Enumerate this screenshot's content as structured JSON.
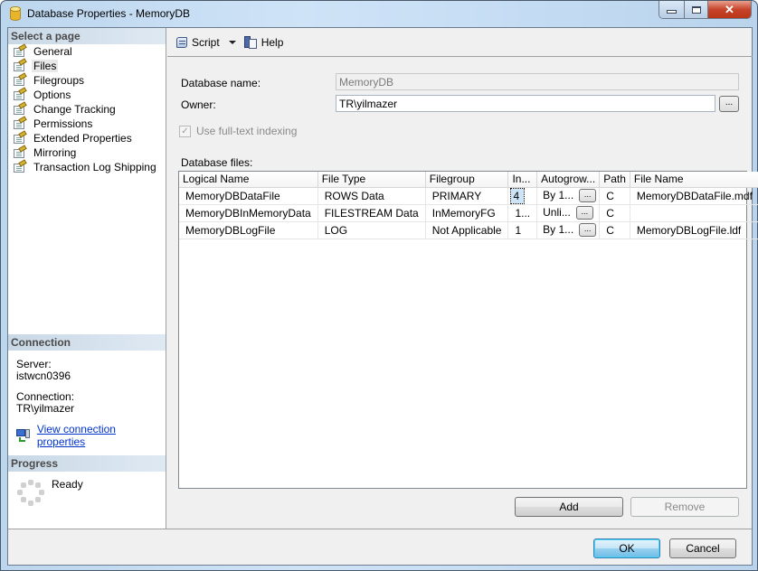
{
  "window": {
    "title": "Database Properties - MemoryDB",
    "controls": {
      "minimize": "minimize",
      "maximize": "maximize",
      "close": "✕"
    }
  },
  "sidebar": {
    "select_page_header": "Select a page",
    "pages": [
      {
        "label": "General",
        "selected": false
      },
      {
        "label": "Files",
        "selected": true
      },
      {
        "label": "Filegroups",
        "selected": false
      },
      {
        "label": "Options",
        "selected": false
      },
      {
        "label": "Change Tracking",
        "selected": false
      },
      {
        "label": "Permissions",
        "selected": false
      },
      {
        "label": "Extended Properties",
        "selected": false
      },
      {
        "label": "Mirroring",
        "selected": false
      },
      {
        "label": "Transaction Log Shipping",
        "selected": false
      }
    ],
    "connection": {
      "header": "Connection",
      "server_label": "Server:",
      "server_value": "istwcn0396",
      "connection_label": "Connection:",
      "connection_value": "TR\\yilmazer",
      "view_link": "View connection properties"
    },
    "progress": {
      "header": "Progress",
      "status": "Ready"
    }
  },
  "toolbar": {
    "script_label": "Script",
    "help_label": "Help"
  },
  "form": {
    "database_name_label": "Database name:",
    "database_name_value": "MemoryDB",
    "owner_label": "Owner:",
    "owner_value": "TR\\yilmazer",
    "owner_browse": "...",
    "fulltext_label": "Use full-text indexing",
    "fulltext_checked": true,
    "database_files_label": "Database files:"
  },
  "files_table": {
    "columns": [
      "Logical Name",
      "File Type",
      "Filegroup",
      "In...",
      "Autogrow...",
      "Path",
      "File Name"
    ],
    "rows": [
      {
        "logical_name": "MemoryDBDataFile",
        "file_type": "ROWS Data",
        "filegroup": "PRIMARY",
        "initial_size": "4",
        "autogrowth": "By 1...",
        "path": "C",
        "file_name": "MemoryDBDataFile.mdf"
      },
      {
        "logical_name": "MemoryDBInMemoryData",
        "file_type": "FILESTREAM Data",
        "filegroup": "InMemoryFG",
        "initial_size": "1...",
        "autogrowth": "Unli...",
        "path": "C",
        "file_name": ""
      },
      {
        "logical_name": "MemoryDBLogFile",
        "file_type": "LOG",
        "filegroup": "Not Applicable",
        "initial_size": "1",
        "autogrowth": "By 1...",
        "path": "C",
        "file_name": "MemoryDBLogFile.ldf"
      }
    ],
    "cell_button": "..."
  },
  "buttons": {
    "add": "Add",
    "remove": "Remove",
    "ok": "OK",
    "cancel": "Cancel"
  }
}
